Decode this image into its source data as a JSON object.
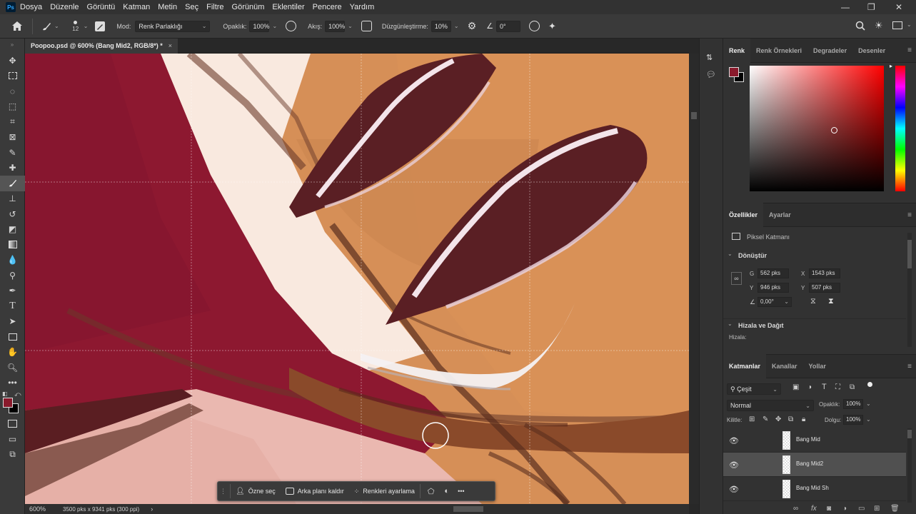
{
  "app": {
    "logo": "Ps"
  },
  "menu": [
    "Dosya",
    "Düzenle",
    "Görüntü",
    "Katman",
    "Metin",
    "Seç",
    "Filtre",
    "Görünüm",
    "Eklentiler",
    "Pencere",
    "Yardım"
  ],
  "window_controls": {
    "minimize": "—",
    "restore": "❐",
    "close": "✕"
  },
  "options": {
    "brush_size": "12",
    "mode_label": "Mod:",
    "mode_value": "Renk Parlaklığı",
    "opacity_label": "Opaklık:",
    "opacity_value": "100%",
    "flow_label": "Akış:",
    "flow_value": "100%",
    "smoothing_label": "Düzgünleştirme:",
    "smoothing_value": "10%",
    "angle_value": "0°"
  },
  "tools": [
    "move-tool",
    "marquee-tool",
    "lasso-tool",
    "object-select-tool",
    "crop-tool",
    "frame-tool",
    "eyedropper-tool",
    "healing-brush-tool",
    "brush-tool",
    "clone-stamp-tool",
    "history-brush-tool",
    "eraser-tool",
    "gradient-tool",
    "blur-tool",
    "dodge-tool",
    "pen-tool",
    "type-tool",
    "path-select-tool",
    "rectangle-tool",
    "hand-tool",
    "zoom-tool",
    "more-tools"
  ],
  "document": {
    "tab_title": "Poopoo.psd @ 600% (Bang Mid2, RGB/8*) *",
    "tab_close": "×",
    "zoom": "600%",
    "dimensions": "3500 pks x 9341 pks (300 ppi)",
    "status_arrow": "›"
  },
  "taskbar": {
    "items": [
      "Özne seç",
      "Arka planı kaldır",
      "Renkleri ayarlama"
    ],
    "more": "•••"
  },
  "color_panel": {
    "tabs": [
      "Renk",
      "Renk Örnekleri",
      "Degradeler",
      "Desenler"
    ],
    "foreground": "#8a1a2c",
    "background": "#000000",
    "hue_color": "#ff0000"
  },
  "properties_panel": {
    "tabs": [
      "Özellikler",
      "Ayarlar"
    ],
    "layer_type": "Piksel Katmanı",
    "transform_title": "Dönüştür",
    "w_label": "G",
    "w_value": "562 pks",
    "x_label": "X",
    "x_value": "1543 pks",
    "h_label": "Y",
    "h_value": "946 pks",
    "y_label": "Y",
    "y_value": "507 pks",
    "angle_value": "0,00°",
    "align_title": "Hizala ve Dağıt",
    "align_label": "Hizala:"
  },
  "layers_panel": {
    "tabs": [
      "Katmanlar",
      "Kanallar",
      "Yollar"
    ],
    "filter_label": "Çeşit",
    "blend_mode": "Normal",
    "opacity_label": "Opaklık:",
    "opacity_value": "100%",
    "lock_label": "Kilitle:",
    "fill_label": "Dolgu:",
    "fill_value": "100%",
    "layers": [
      {
        "name": "Bang Mid"
      },
      {
        "name": "Bang Mid2"
      },
      {
        "name": "Bang Mid Sh"
      }
    ]
  }
}
